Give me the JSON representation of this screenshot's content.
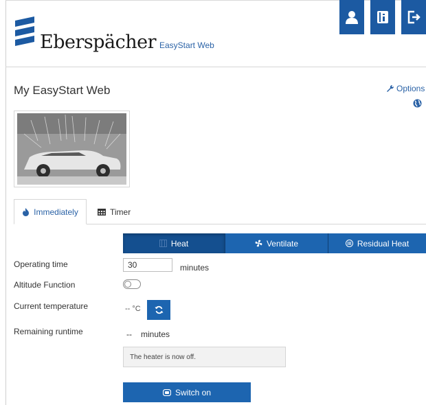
{
  "header": {
    "brand": "Eberspächer",
    "app_name": "EasyStart Web",
    "buttons": [
      "user-icon",
      "manual-icon",
      "logout-icon"
    ]
  },
  "page": {
    "title": "My EasyStart Web",
    "options_label": "Options"
  },
  "tabs": [
    {
      "label": "Immediately",
      "icon": "flame-icon",
      "active": true
    },
    {
      "label": "Timer",
      "icon": "calendar-icon",
      "active": false
    }
  ],
  "modes": [
    {
      "label": "Heat",
      "icon": "heater-icon",
      "active": true
    },
    {
      "label": "Ventilate",
      "icon": "fan-icon",
      "active": false
    },
    {
      "label": "Residual Heat",
      "icon": "residual-heat-icon",
      "active": false
    }
  ],
  "form": {
    "operating_time_label": "Operating time",
    "operating_time_value": "30",
    "operating_time_unit": "minutes",
    "altitude_label": "Altitude Function",
    "altitude_enabled": false,
    "current_temp_label": "Current temperature",
    "current_temp_value": "-- °C",
    "remaining_label": "Remaining runtime",
    "remaining_value": "--",
    "remaining_unit": "minutes"
  },
  "status_message": "The heater is now off.",
  "switch_on_label": "Switch on",
  "colors": {
    "primary": "#1d65b0",
    "primary_dark": "#144f8f",
    "link": "#2a62a6"
  }
}
